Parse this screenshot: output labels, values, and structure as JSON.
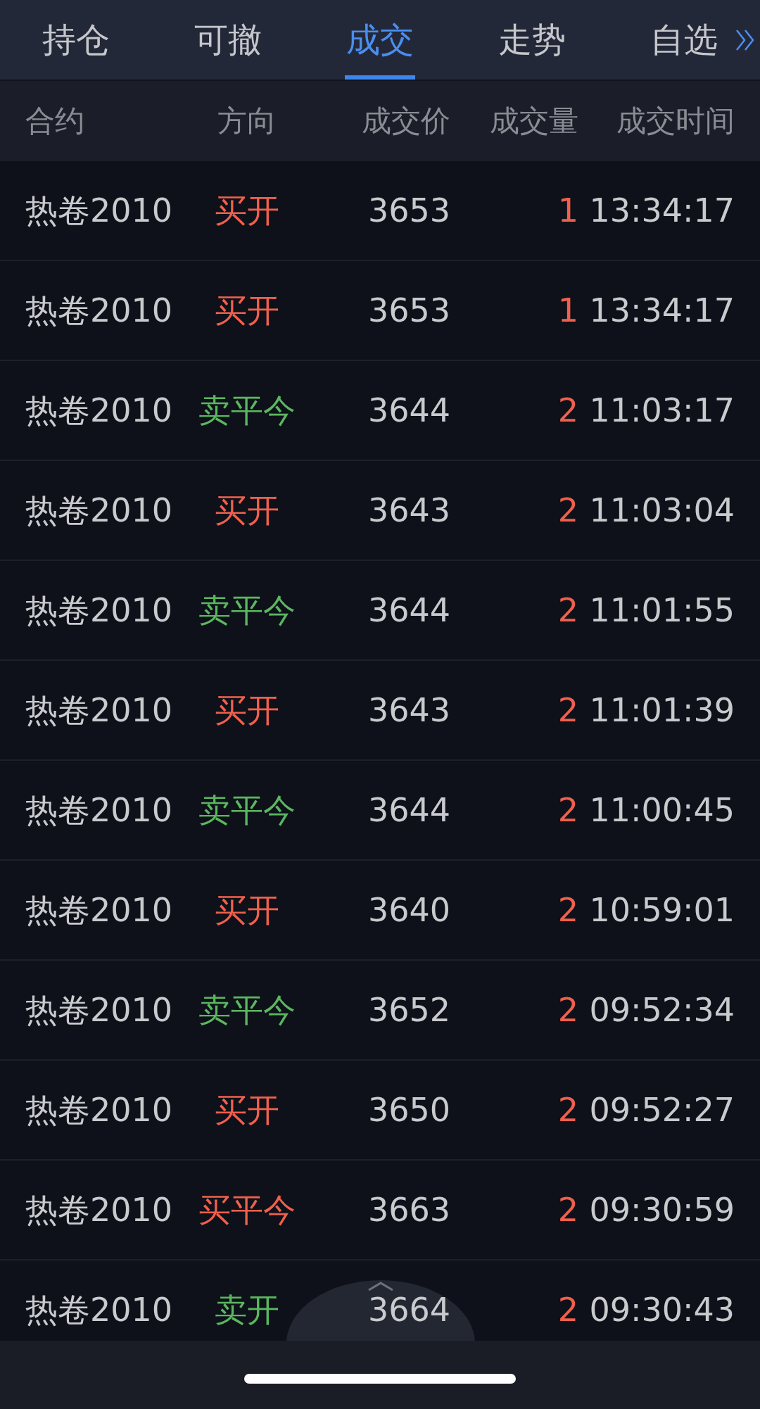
{
  "tabs": [
    {
      "label": "持仓",
      "selected": false
    },
    {
      "label": "可撤",
      "selected": false
    },
    {
      "label": "成交",
      "selected": true
    },
    {
      "label": "走势",
      "selected": false
    },
    {
      "label": "自选",
      "selected": false
    }
  ],
  "table": {
    "columns": [
      "合约",
      "方向",
      "成交价",
      "成交量",
      "成交时间"
    ],
    "rows": [
      {
        "contract": "热卷2010",
        "direction": "买开",
        "kind": "buy",
        "price": "3653",
        "quantity": "1",
        "time": "13:34:17"
      },
      {
        "contract": "热卷2010",
        "direction": "买开",
        "kind": "buy",
        "price": "3653",
        "quantity": "1",
        "time": "13:34:17"
      },
      {
        "contract": "热卷2010",
        "direction": "卖平今",
        "kind": "sell",
        "price": "3644",
        "quantity": "2",
        "time": "11:03:17"
      },
      {
        "contract": "热卷2010",
        "direction": "买开",
        "kind": "buy",
        "price": "3643",
        "quantity": "2",
        "time": "11:03:04"
      },
      {
        "contract": "热卷2010",
        "direction": "卖平今",
        "kind": "sell",
        "price": "3644",
        "quantity": "2",
        "time": "11:01:55"
      },
      {
        "contract": "热卷2010",
        "direction": "买开",
        "kind": "buy",
        "price": "3643",
        "quantity": "2",
        "time": "11:01:39"
      },
      {
        "contract": "热卷2010",
        "direction": "卖平今",
        "kind": "sell",
        "price": "3644",
        "quantity": "2",
        "time": "11:00:45"
      },
      {
        "contract": "热卷2010",
        "direction": "买开",
        "kind": "buy",
        "price": "3640",
        "quantity": "2",
        "time": "10:59:01"
      },
      {
        "contract": "热卷2010",
        "direction": "卖平今",
        "kind": "sell",
        "price": "3652",
        "quantity": "2",
        "time": "09:52:34"
      },
      {
        "contract": "热卷2010",
        "direction": "买开",
        "kind": "buy",
        "price": "3650",
        "quantity": "2",
        "time": "09:52:27"
      },
      {
        "contract": "热卷2010",
        "direction": "买平今",
        "kind": "buy",
        "price": "3663",
        "quantity": "2",
        "time": "09:30:59"
      },
      {
        "contract": "热卷2010",
        "direction": "卖开",
        "kind": "sell",
        "price": "3664",
        "quantity": "2",
        "time": "09:30:43"
      }
    ]
  }
}
